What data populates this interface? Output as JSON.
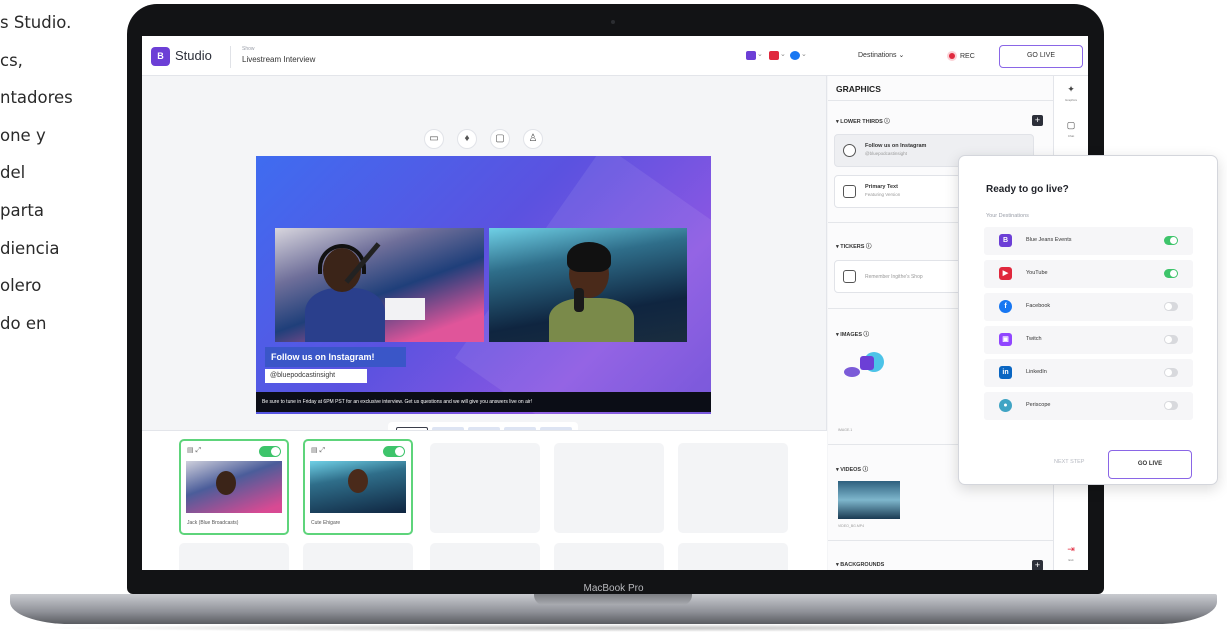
{
  "side_text": {
    "lines": [
      "s Studio.",
      "cs,",
      "ntadores",
      "one y",
      "del",
      "parta",
      "diencia",
      "olero",
      "do en"
    ]
  },
  "laptop": {
    "label": "MacBook Pro"
  },
  "header": {
    "logo_text": "B",
    "app_name": "Studio",
    "show_label": "Show",
    "show_title": "Livestream Interview",
    "destinations_label": "Destinations",
    "destinations_caret": "⌄",
    "rec_label": "REC",
    "go_live_label": "GO LIVE",
    "colors": {
      "brand": "#6c3fd6",
      "youtube": "#e0283d",
      "facebook": "#1877f2",
      "go_live_border": "#8a66e6"
    }
  },
  "canvas": {
    "controls": [
      {
        "name": "camera-icon",
        "glyph": "▭"
      },
      {
        "name": "microphone-icon",
        "glyph": "♦"
      },
      {
        "name": "screen-share-icon",
        "glyph": "▢"
      },
      {
        "name": "invite-guest-icon",
        "glyph": "♙"
      }
    ],
    "lower_third_title": "Follow us on Instagram!",
    "lower_third_subtitle": "@bluepodcastinsight",
    "ticker_text": "Be sure to tune in Friday at 6PM PST for an exclusive interview. Get us questions and we will give you answers live on air!"
  },
  "sources": {
    "cards": [
      {
        "name": "Jack (Blue Broadcasts)",
        "mic": "🎙"
      },
      {
        "name": "Cute Ehigare",
        "mic": "🎙"
      }
    ],
    "card_controls": "▤ ⤢"
  },
  "graphics": {
    "title": "GRAPHICS",
    "sections": {
      "lower_thirds": "▾ LOWER THIRDS ⓘ",
      "tickers": "▾ TICKERS ⓘ",
      "images": "▾ IMAGES ⓘ",
      "videos": "▾ VIDEOS ⓘ",
      "backgrounds": "▾ BACKGROUNDS"
    },
    "lower_thirds": [
      {
        "title": "Follow us on Instagram",
        "subtitle": "@bluepodcastinsight"
      },
      {
        "title": "Primary Text",
        "subtitle": "Featuring Version"
      }
    ],
    "ticker_item": "Remember Ingithe's Shop",
    "image_caption": "IMAGE.1",
    "video_caption": "VIDEO_BG.MP4",
    "plus": "+"
  },
  "rail": [
    {
      "icon": "graphics-icon",
      "glyph": "✦",
      "label": "Graphics"
    },
    {
      "icon": "chat-icon",
      "glyph": "▢",
      "label": "Chat"
    },
    {
      "icon": "exit-icon",
      "glyph": "⇥",
      "label": "Exit"
    }
  ],
  "modal": {
    "title": "Ready to go live?",
    "subtitle": "Your Destinations",
    "destinations": [
      {
        "name": "Blue Jeans Events",
        "icon": "bluejeans-icon",
        "glyph": "B",
        "color": "#6c3fd6",
        "enabled": true
      },
      {
        "name": "YouTube",
        "icon": "youtube-icon",
        "glyph": "▶",
        "color": "#e0283d",
        "enabled": true
      },
      {
        "name": "Facebook",
        "icon": "facebook-icon",
        "glyph": "f",
        "color": "#1877f2",
        "enabled": false
      },
      {
        "name": "Twitch",
        "icon": "twitch-icon",
        "glyph": "▣",
        "color": "#9146ff",
        "enabled": false
      },
      {
        "name": "LinkedIn",
        "icon": "linkedin-icon",
        "glyph": "in",
        "color": "#0a66c2",
        "enabled": false
      },
      {
        "name": "Periscope",
        "icon": "periscope-icon",
        "glyph": "●",
        "color": "#40a4c4",
        "enabled": false
      }
    ],
    "next_label": "NEXT STEP",
    "go_live_label": "GO LIVE"
  }
}
